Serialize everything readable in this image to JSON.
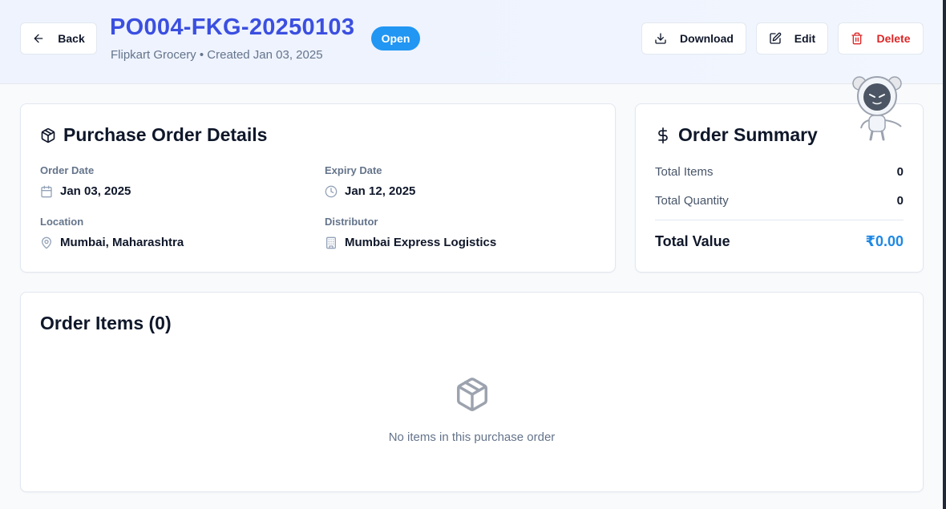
{
  "header": {
    "back_label": "Back",
    "po_number": "PO004-FKG-20250103",
    "subtitle": "Flipkart Grocery • Created Jan 03, 2025",
    "status": "Open",
    "download_label": "Download",
    "edit_label": "Edit",
    "delete_label": "Delete"
  },
  "details": {
    "title": "Purchase Order Details",
    "icon": "package-icon",
    "order_date": {
      "label": "Order Date",
      "value": "Jan 03, 2025",
      "icon": "calendar-icon"
    },
    "expiry_date": {
      "label": "Expiry Date",
      "value": "Jan 12, 2025",
      "icon": "clock-icon"
    },
    "location": {
      "label": "Location",
      "value": "Mumbai, Maharashtra",
      "icon": "map-pin-icon"
    },
    "distributor": {
      "label": "Distributor",
      "value": "Mumbai Express Logistics",
      "icon": "building-icon"
    }
  },
  "summary": {
    "title": "Order Summary",
    "icon": "dollar-icon",
    "total_items_label": "Total Items",
    "total_items": "0",
    "total_quantity_label": "Total Quantity",
    "total_quantity": "0",
    "total_value_label": "Total Value",
    "total_value": "₹0.00"
  },
  "items": {
    "title": "Order Items (0)",
    "empty_text": "No items in this purchase order",
    "icon": "package-icon"
  },
  "colors": {
    "title_blue": "#3b4fe0",
    "badge_blue": "#2196f3",
    "delete_red": "#dc2626",
    "total_value_blue": "#1e88e5",
    "header_bg": "#eef3fe"
  }
}
